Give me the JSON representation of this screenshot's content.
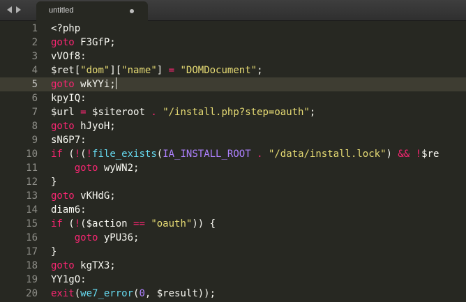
{
  "tab": {
    "title": "untitled"
  },
  "editor": {
    "current_line": 5,
    "lines": [
      {
        "number": "1",
        "tokens": [
          {
            "t": "<?php",
            "c": "plain"
          }
        ]
      },
      {
        "number": "2",
        "tokens": [
          {
            "t": "goto",
            "c": "kw"
          },
          {
            "t": " F3GfP;",
            "c": "plain"
          }
        ]
      },
      {
        "number": "3",
        "tokens": [
          {
            "t": "vVOf8:",
            "c": "plain"
          }
        ]
      },
      {
        "number": "4",
        "tokens": [
          {
            "t": "$ret[",
            "c": "plain"
          },
          {
            "t": "\"dom\"",
            "c": "str"
          },
          {
            "t": "][",
            "c": "plain"
          },
          {
            "t": "\"name\"",
            "c": "str"
          },
          {
            "t": "] ",
            "c": "plain"
          },
          {
            "t": "=",
            "c": "kw"
          },
          {
            "t": " ",
            "c": "plain"
          },
          {
            "t": "\"DOMDocument\"",
            "c": "str"
          },
          {
            "t": ";",
            "c": "plain"
          }
        ]
      },
      {
        "number": "5",
        "tokens": [
          {
            "t": "goto",
            "c": "kw"
          },
          {
            "t": " wkYYi;",
            "c": "plain"
          }
        ]
      },
      {
        "number": "6",
        "tokens": [
          {
            "t": "kpyIQ:",
            "c": "plain"
          }
        ]
      },
      {
        "number": "7",
        "tokens": [
          {
            "t": "$url ",
            "c": "plain"
          },
          {
            "t": "=",
            "c": "kw"
          },
          {
            "t": " $siteroot ",
            "c": "plain"
          },
          {
            "t": ".",
            "c": "kw"
          },
          {
            "t": " ",
            "c": "plain"
          },
          {
            "t": "\"/install.php?step=oauth\"",
            "c": "str"
          },
          {
            "t": ";",
            "c": "plain"
          }
        ]
      },
      {
        "number": "8",
        "tokens": [
          {
            "t": "goto",
            "c": "kw"
          },
          {
            "t": " hJyoH;",
            "c": "plain"
          }
        ]
      },
      {
        "number": "9",
        "tokens": [
          {
            "t": "sN6P7:",
            "c": "plain"
          }
        ]
      },
      {
        "number": "10",
        "tokens": [
          {
            "t": "if",
            "c": "kw"
          },
          {
            "t": " (",
            "c": "plain"
          },
          {
            "t": "!",
            "c": "kw"
          },
          {
            "t": "(",
            "c": "plain"
          },
          {
            "t": "!",
            "c": "kw"
          },
          {
            "t": "file_exists",
            "c": "fn"
          },
          {
            "t": "(",
            "c": "plain"
          },
          {
            "t": "IA_INSTALL_ROOT",
            "c": "const"
          },
          {
            "t": " ",
            "c": "plain"
          },
          {
            "t": ".",
            "c": "kw"
          },
          {
            "t": " ",
            "c": "plain"
          },
          {
            "t": "\"/data/install.lock\"",
            "c": "str"
          },
          {
            "t": ") ",
            "c": "plain"
          },
          {
            "t": "&&",
            "c": "kw"
          },
          {
            "t": " ",
            "c": "plain"
          },
          {
            "t": "!",
            "c": "kw"
          },
          {
            "t": "$re",
            "c": "plain"
          }
        ]
      },
      {
        "number": "11",
        "tokens": [
          {
            "t": "    ",
            "c": "plain"
          },
          {
            "t": "goto",
            "c": "kw"
          },
          {
            "t": " wyWN2;",
            "c": "plain"
          }
        ]
      },
      {
        "number": "12",
        "tokens": [
          {
            "t": "}",
            "c": "plain"
          }
        ]
      },
      {
        "number": "13",
        "tokens": [
          {
            "t": "goto",
            "c": "kw"
          },
          {
            "t": " vKHdG;",
            "c": "plain"
          }
        ]
      },
      {
        "number": "14",
        "tokens": [
          {
            "t": "diam6:",
            "c": "plain"
          }
        ]
      },
      {
        "number": "15",
        "tokens": [
          {
            "t": "if",
            "c": "kw"
          },
          {
            "t": " (",
            "c": "plain"
          },
          {
            "t": "!",
            "c": "kw"
          },
          {
            "t": "($action ",
            "c": "plain"
          },
          {
            "t": "==",
            "c": "kw"
          },
          {
            "t": " ",
            "c": "plain"
          },
          {
            "t": "\"oauth\"",
            "c": "str"
          },
          {
            "t": ")) {",
            "c": "plain"
          }
        ]
      },
      {
        "number": "16",
        "tokens": [
          {
            "t": "    ",
            "c": "plain"
          },
          {
            "t": "goto",
            "c": "kw"
          },
          {
            "t": " yPU36;",
            "c": "plain"
          }
        ]
      },
      {
        "number": "17",
        "tokens": [
          {
            "t": "}",
            "c": "plain"
          }
        ]
      },
      {
        "number": "18",
        "tokens": [
          {
            "t": "goto",
            "c": "kw"
          },
          {
            "t": " kgTX3;",
            "c": "plain"
          }
        ]
      },
      {
        "number": "19",
        "tokens": [
          {
            "t": "YY1gO:",
            "c": "plain"
          }
        ]
      },
      {
        "number": "20",
        "tokens": [
          {
            "t": "exit",
            "c": "kw"
          },
          {
            "t": "(",
            "c": "plain"
          },
          {
            "t": "we7_error",
            "c": "fn"
          },
          {
            "t": "(",
            "c": "plain"
          },
          {
            "t": "0",
            "c": "const"
          },
          {
            "t": ", $result));",
            "c": "plain"
          }
        ]
      }
    ]
  },
  "colors": {
    "background": "#272822",
    "keyword": "#f92672",
    "string": "#e6db74",
    "function": "#66d9ef",
    "constant": "#ae81ff",
    "plain": "#f8f8f2",
    "gutter": "#90908a",
    "current_line": "#3e3d32"
  },
  "icons": {
    "nav_back": "left-arrow-icon",
    "nav_forward": "right-arrow-icon",
    "tab_unsaved": "unsaved-dot-icon"
  }
}
